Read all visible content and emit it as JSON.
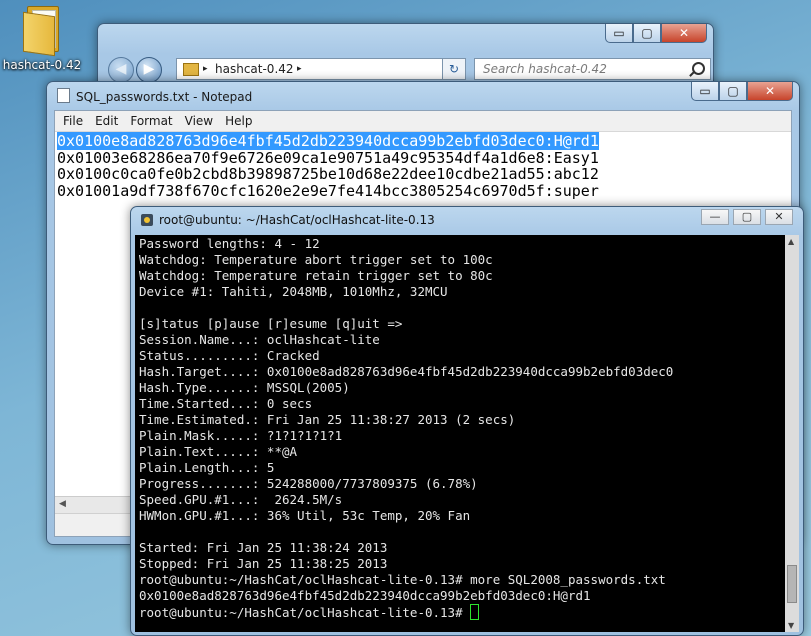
{
  "desktop": {
    "icon_label": "hashcat-0.42"
  },
  "explorer": {
    "address": "hashcat-0.42",
    "search_placeholder": "Search hashcat-0.42",
    "btn_min": "▭",
    "btn_max": "▢",
    "btn_close": "✕",
    "back_glyph": "◀",
    "fwd_glyph": "▶",
    "sep_glyph": "▸",
    "drop_glyph": "▾",
    "refresh_glyph": "↻"
  },
  "notepad": {
    "title": "SQL_passwords.txt - Notepad",
    "menu": [
      "File",
      "Edit",
      "Format",
      "View",
      "Help"
    ],
    "lines": [
      "0x0100e8ad828763d96e4fbf45d2db223940dcca99b2ebfd03dec0:H@rd1",
      "0x01003e68286ea70f9e6726e09ca1e90751a49c95354df4a1d6e8:Easy1",
      "0x0100c0ca0fe0b2cbd8b39898725be10d68e22dee10cdbe21ad55:abc12",
      "0x01001a9df738f670cfc1620e2e9e7fe414bcc3805254c6970d5f:super"
    ],
    "hscroll_left": "◀"
  },
  "terminal": {
    "title": "root@ubuntu: ~/HashCat/oclHashcat-lite-0.13",
    "btn_min": "—",
    "btn_max": "▢",
    "btn_close": "✕",
    "scroll_up": "▲",
    "scroll_down": "▼",
    "lines": [
      "Password lengths: 4 - 12",
      "Watchdog: Temperature abort trigger set to 100c",
      "Watchdog: Temperature retain trigger set to 80c",
      "Device #1: Tahiti, 2048MB, 1010Mhz, 32MCU",
      "",
      "[s]tatus [p]ause [r]esume [q]uit =>",
      "Session.Name...: oclHashcat-lite",
      "Status.........: Cracked",
      "Hash.Target....: 0x0100e8ad828763d96e4fbf45d2db223940dcca99b2ebfd03dec0",
      "Hash.Type......: MSSQL(2005)",
      "Time.Started...: 0 secs",
      "Time.Estimated.: Fri Jan 25 11:38:27 2013 (2 secs)",
      "Plain.Mask.....: ?1?1?1?1?1",
      "Plain.Text.....: **@A",
      "Plain.Length...: 5",
      "Progress.......: 524288000/7737809375 (6.78%)",
      "Speed.GPU.#1...:  2624.5M/s",
      "HWMon.GPU.#1...: 36% Util, 53c Temp, 20% Fan",
      "",
      "Started: Fri Jan 25 11:38:24 2013",
      "Stopped: Fri Jan 25 11:38:25 2013",
      "root@ubuntu:~/HashCat/oclHashcat-lite-0.13# more SQL2008_passwords.txt",
      "0x0100e8ad828763d96e4fbf45d2db223940dcca99b2ebfd03dec0:H@rd1"
    ],
    "prompt": "root@ubuntu:~/HashCat/oclHashcat-lite-0.13# "
  }
}
